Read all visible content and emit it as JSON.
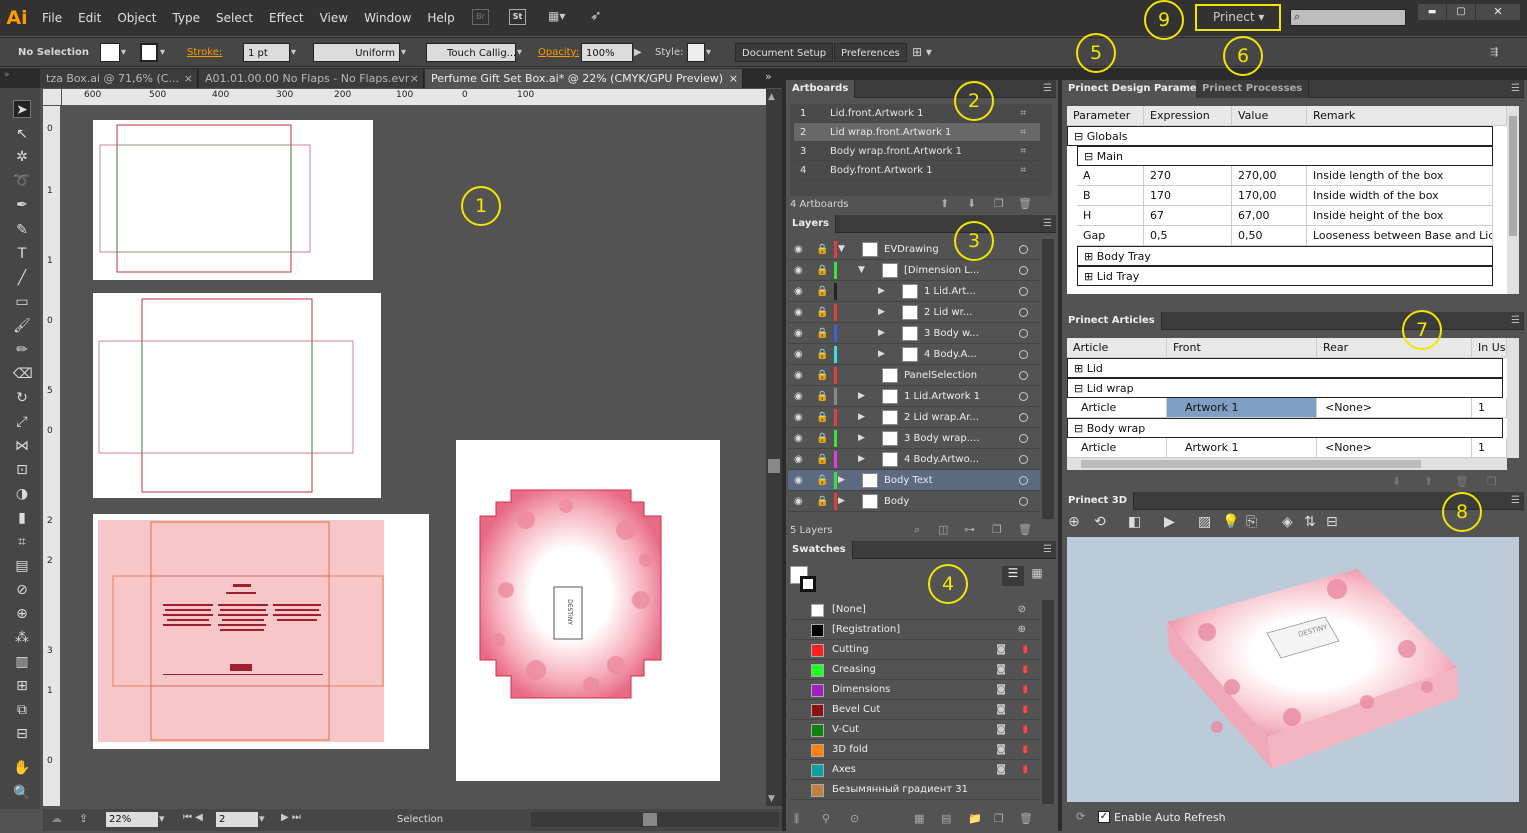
{
  "menubar": {
    "logo": "Ai",
    "items": [
      "File",
      "Edit",
      "Object",
      "Type",
      "Select",
      "Effect",
      "View",
      "Window",
      "Help"
    ],
    "bridge": "Br",
    "stock": "St",
    "workspace": "Prinect",
    "win_min": "▬",
    "win_max": "▢",
    "win_close": "✕"
  },
  "control": {
    "selection": "No Selection",
    "stroke_label": "Stroke:",
    "stroke_value": "1 pt",
    "profile": "Uniform",
    "brush": "Touch Callig...",
    "opacity_label": "Opacity:",
    "opacity_value": "100%",
    "style_label": "Style:",
    "document_setup": "Document Setup",
    "preferences": "Preferences"
  },
  "tabs": [
    {
      "label": "tza Box.ai @ 71,6% (C..."
    },
    {
      "label": "A01.01.00.00 No Flaps - No Flaps.evr"
    },
    {
      "label": "Perfume Gift Set Box.ai* @ 22% (CMYK/GPU Preview)"
    }
  ],
  "ruler": {
    "h": [
      "600",
      "500",
      "400",
      "300",
      "200",
      "100",
      "0",
      "100"
    ],
    "v": [
      "0",
      "1",
      "1",
      "0",
      "5",
      "0",
      "2",
      "2",
      "3",
      "1",
      "0"
    ]
  },
  "artboards": {
    "title": "Artboards",
    "items": [
      {
        "num": "1",
        "name": "Lid.front.Artwork 1"
      },
      {
        "num": "2",
        "name": "Lid wrap.front.Artwork 1"
      },
      {
        "num": "3",
        "name": "Body wrap.front.Artwork 1"
      },
      {
        "num": "4",
        "name": "Body.front.Artwork 1"
      }
    ],
    "count": "4 Artboards"
  },
  "layers": {
    "title": "Layers",
    "count": "5 Layers",
    "items": [
      {
        "name": "EVDrawing",
        "color": "#e04040",
        "indent": 0,
        "arrow": "▼"
      },
      {
        "name": "[Dimension L...",
        "color": "#40e040",
        "indent": 1,
        "arrow": "▼"
      },
      {
        "name": "1 Lid.Art...",
        "color": "#222",
        "indent": 2,
        "arrow": "▶"
      },
      {
        "name": "2 Lid wr...",
        "color": "#e04040",
        "indent": 2,
        "arrow": "▶"
      },
      {
        "name": "3 Body w...",
        "color": "#4060e0",
        "indent": 2,
        "arrow": "▶"
      },
      {
        "name": "4 Body.A...",
        "color": "#40e0e0",
        "indent": 2,
        "arrow": "▶"
      },
      {
        "name": "PanelSelection",
        "color": "#e04040",
        "indent": 1,
        "arrow": ""
      },
      {
        "name": "1 Lid.Artwork 1",
        "color": "#888",
        "indent": 1,
        "arrow": "▶"
      },
      {
        "name": "2 Lid wrap.Ar...",
        "color": "#e04040",
        "indent": 1,
        "arrow": "▶"
      },
      {
        "name": "3 Body wrap....",
        "color": "#40e040",
        "indent": 1,
        "arrow": "▶"
      },
      {
        "name": "4 Body.Artwo...",
        "color": "#e040e0",
        "indent": 1,
        "arrow": "▶"
      },
      {
        "name": "Body Text",
        "color": "#40e040",
        "indent": 0,
        "arrow": "▶"
      },
      {
        "name": "Body",
        "color": "#e04040",
        "indent": 0,
        "arrow": "▶"
      }
    ]
  },
  "swatches": {
    "title": "Swatches",
    "items": [
      {
        "name": "[None]",
        "color": "#ffffff"
      },
      {
        "name": "[Registration]",
        "color": "#000000"
      },
      {
        "name": "Cutting",
        "color": "#ff2020"
      },
      {
        "name": "Creasing",
        "color": "#20ff20"
      },
      {
        "name": "Dimensions",
        "color": "#a020c0"
      },
      {
        "name": "Bevel Cut",
        "color": "#8b1010"
      },
      {
        "name": "V-Cut",
        "color": "#108010"
      },
      {
        "name": "3D fold",
        "color": "#ff8000"
      },
      {
        "name": "Axes",
        "color": "#10a0a0"
      },
      {
        "name": "Безымянный градиент 31",
        "color": "#c08040"
      }
    ]
  },
  "design_params": {
    "tab1": "Prinect Design Parameters",
    "tab2": "Prinect Processes",
    "headers": [
      "Parameter",
      "Expression",
      "Value",
      "Remark"
    ],
    "groups": {
      "globals": "Globals",
      "main": "Main",
      "body_tray": "Body Tray",
      "lid_tray": "Lid Tray"
    },
    "rows": [
      {
        "param": "A",
        "expr": "270",
        "value": "270,00",
        "remark": "Inside length of the box"
      },
      {
        "param": "B",
        "expr": "170",
        "value": "170,00",
        "remark": "Inside width of the box"
      },
      {
        "param": "H",
        "expr": "67",
        "value": "67,00",
        "remark": "Inside height of the box"
      },
      {
        "param": "Gap",
        "expr": "0,5",
        "value": "0,50",
        "remark": "Looseness between Base and Lid ..."
      }
    ]
  },
  "articles": {
    "title": "Prinect Articles",
    "headers": [
      "Article",
      "Front",
      "Rear",
      "In Us"
    ],
    "groups": {
      "lid": "Lid",
      "lid_wrap": "Lid wrap",
      "body_wrap": "Body wrap"
    },
    "rows": [
      {
        "article": "Article",
        "front": "Artwork 1",
        "rear": "<None>",
        "inuse": "1"
      },
      {
        "article": "Article",
        "front": "Artwork 1",
        "rear": "<None>",
        "inuse": "1"
      }
    ]
  },
  "prinect3d": {
    "title": "Prinect 3D",
    "auto_refresh": "Enable Auto Refresh",
    "brand": "DESTINY"
  },
  "status": {
    "zoom": "22%",
    "page": "2",
    "mode": "Selection"
  },
  "badges": [
    "1",
    "2",
    "3",
    "4",
    "5",
    "6",
    "7",
    "8",
    "9"
  ],
  "colors": {
    "accent": "#ff9a00",
    "badge": "#f3e600",
    "selection": "#5b6a80",
    "article_select": "#7e9ec4"
  }
}
